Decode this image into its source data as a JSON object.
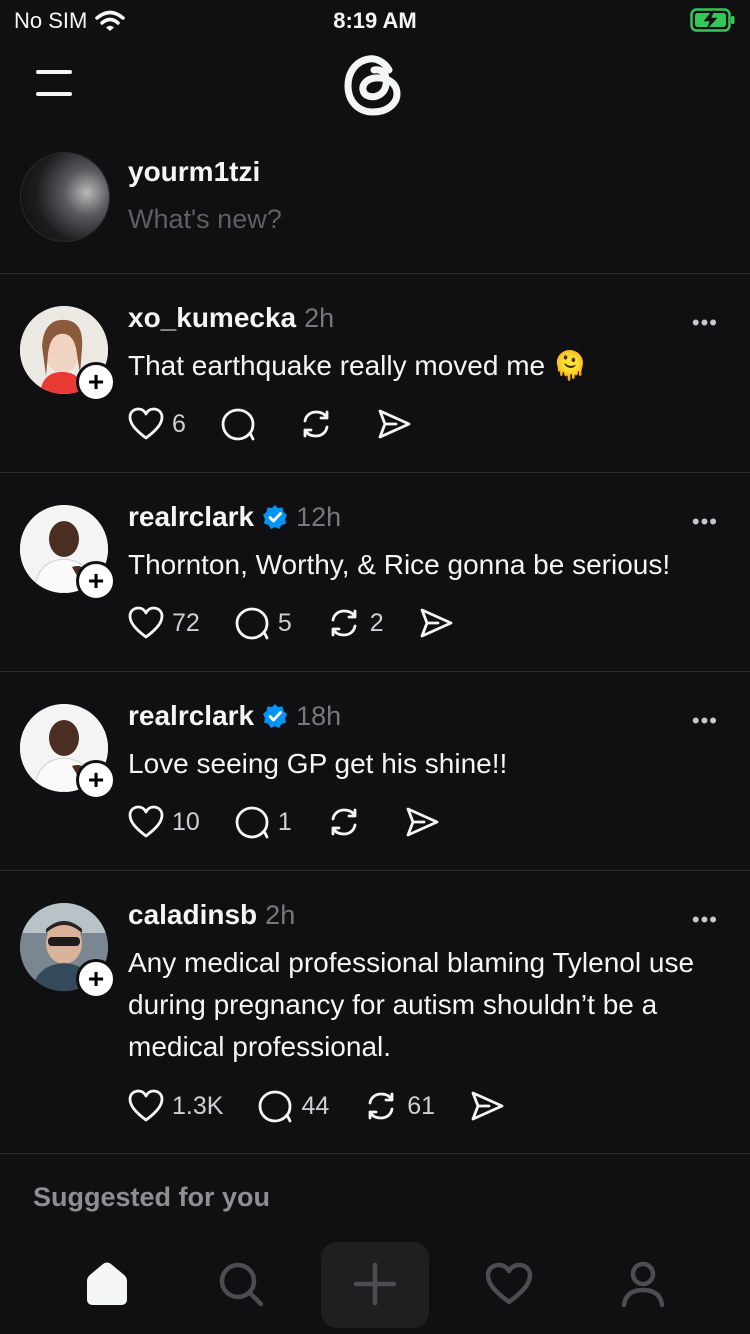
{
  "status_bar": {
    "carrier": "No SIM",
    "time": "8:19 AM"
  },
  "composer": {
    "username": "yourm1tzi",
    "placeholder": "What's new?"
  },
  "posts": [
    {
      "username": "xo_kumecka",
      "time": "2h",
      "verified": false,
      "text": "That earthquake really moved me 🫠",
      "likes": "6",
      "replies": "",
      "reposts": ""
    },
    {
      "username": "realrclark",
      "time": "12h",
      "verified": true,
      "text": "Thornton, Worthy, & Rice gonna be serious!",
      "likes": "72",
      "replies": "5",
      "reposts": "2"
    },
    {
      "username": "realrclark",
      "time": "18h",
      "verified": true,
      "text": "Love seeing GP get his shine!!",
      "likes": "10",
      "replies": "1",
      "reposts": ""
    },
    {
      "username": "caladinsb",
      "time": "2h",
      "verified": false,
      "text": "Any medical professional blaming Tylenol use during pregnancy for autism shouldn’t be a medical professional.",
      "likes": "1.3K",
      "replies": "44",
      "reposts": "61"
    }
  ],
  "suggested_label": "Suggested for you",
  "more_glyph": "•••",
  "follow_glyph": "+",
  "colors": {
    "background": "#101012",
    "text": "#f3f5f7",
    "muted": "#77787c",
    "verified": "#0095f6"
  },
  "tabs": [
    "home-icon",
    "search-icon",
    "plus-icon",
    "heart-icon",
    "profile-icon"
  ]
}
